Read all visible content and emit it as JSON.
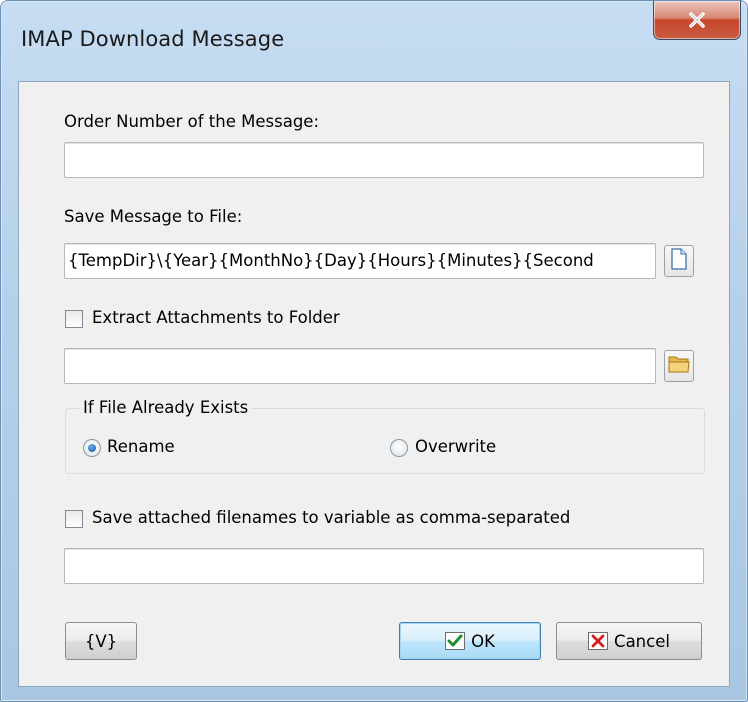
{
  "window": {
    "title": "IMAP Download Message",
    "close_glyph": "✕"
  },
  "fields": {
    "order_label": "Order Number of the Message:",
    "order_value": "",
    "save_label": "Save Message to File:",
    "save_value": "{TempDir}\\{Year}{MonthNo}{Day}{Hours}{Minutes}{Second",
    "extract_label": "Extract Attachments to Folder",
    "extract_checked": false,
    "extract_value": "",
    "exists_group_title": "If File Already Exists",
    "rename_label": "Rename",
    "overwrite_label": "Overwrite",
    "exists_selected": "Rename",
    "save_names_label": "Save attached filenames to variable as comma-separated",
    "save_names_checked": false,
    "save_names_value": ""
  },
  "buttons": {
    "variables_label": "{V}",
    "ok_label": "OK",
    "cancel_label": "Cancel"
  },
  "icons": {
    "file_browse": "file-icon",
    "folder_browse": "folder-icon",
    "ok": "check-icon",
    "cancel": "x-icon"
  },
  "colors": {
    "titlebar": "#b9d3ec",
    "close_button": "#c7472b",
    "dialog_bg": "#f0f0f0",
    "default_button_border": "#3c7fb1"
  }
}
